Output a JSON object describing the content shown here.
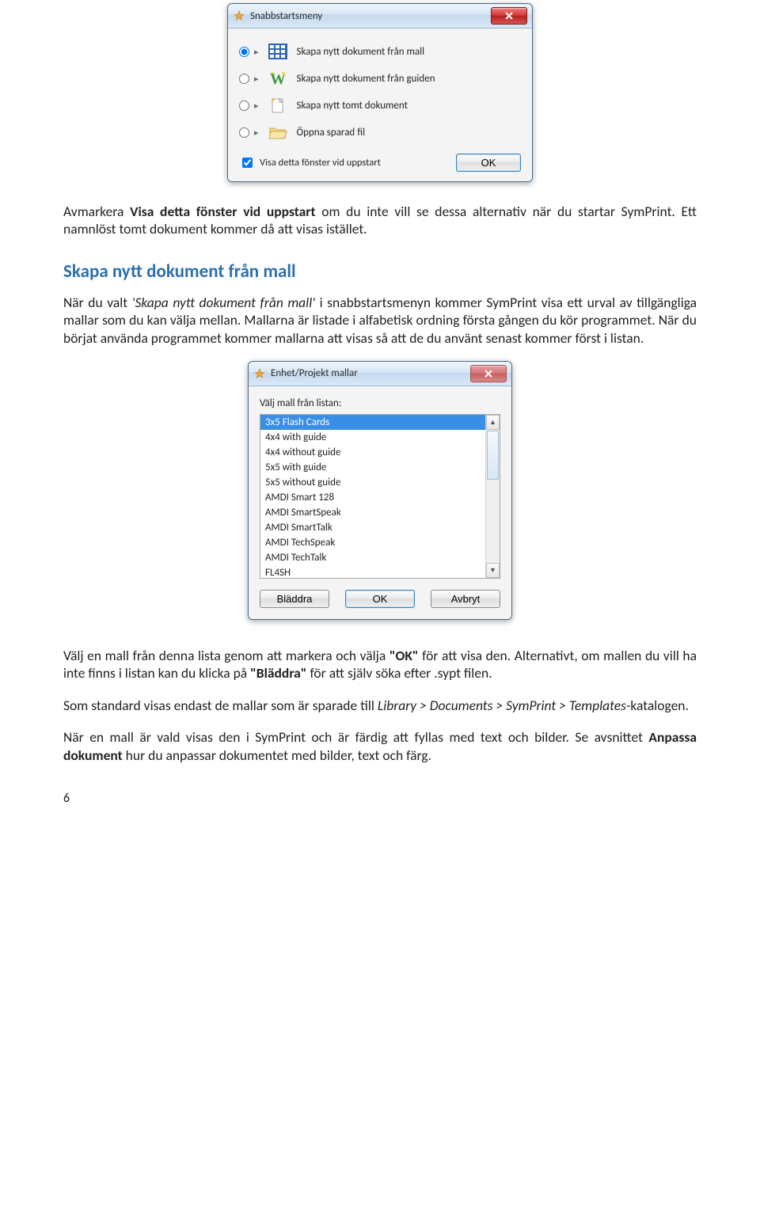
{
  "dialog1": {
    "title": "Snabbstartsmeny",
    "options": [
      {
        "label": "Skapa nytt dokument från mall",
        "icon": "grid-icon",
        "selected": true
      },
      {
        "label": "Skapa nytt dokument från guiden",
        "icon": "wizard-w-icon",
        "selected": false
      },
      {
        "label": "Skapa nytt tomt dokument",
        "icon": "new-doc-icon",
        "selected": false
      },
      {
        "label": "Öppna sparad fil",
        "icon": "folder-icon",
        "selected": false
      }
    ],
    "checkbox_label": "Visa detta fönster vid uppstart",
    "checkbox_checked": true,
    "ok_label": "OK"
  },
  "para1": {
    "pre": "Avmarkera ",
    "bold": "Visa detta fönster vid uppstart",
    "post": " om du inte vill se dessa alternativ när du startar SymPrint. Ett namnlöst tomt dokument kommer då att visas istället."
  },
  "section_heading": "Skapa nytt dokument från mall",
  "para2": {
    "pre": "När du valt ",
    "quoted": "'Skapa nytt dokument från mall'",
    "post": " i snabbstartsmenyn kommer SymPrint visa ett urval av tillgängliga mallar som du kan välja mellan. Mallarna är listade i alfabetisk ordning första gången du kör programmet. När du börjat använda programmet kommer mallarna att visas så att de du använt senast kommer först i listan."
  },
  "dialog2": {
    "title": "Enhet/Projekt mallar",
    "prompt": "Välj mall från listan:",
    "items": [
      "3x5 Flash Cards",
      "4x4 with guide",
      "4x4 without guide",
      "5x5 with guide",
      "5x5 without guide",
      "AMDI Smart 128",
      "AMDI SmartSpeak",
      "AMDI SmartTalk",
      "AMDI TechSpeak",
      "AMDI TechTalk",
      "FL4SH"
    ],
    "selected_index": 0,
    "browse_label": "Bläddra",
    "ok_label": "OK",
    "cancel_label": "Avbryt"
  },
  "para3": {
    "pre": "Välj en mall från denna lista genom att markera och välja ",
    "ok_bold": "\"OK\"",
    "mid": " för att visa den. Alternativt, om mallen du vill ha inte finns i listan kan du klicka på ",
    "browse_bold": "\"Bläddra\"",
    "post": " för att själv söka efter .sypt filen."
  },
  "para4": {
    "pre": "Som standard visas endast de mallar som är sparade till ",
    "path_italic": "Library > Documents > SymPrint > Templates",
    "post": "-katalogen."
  },
  "para5": {
    "pre": "När en mall är vald visas den i SymPrint och är färdig att fyllas med text och bilder. Se avsnittet ",
    "bold": "Anpassa dokument",
    "post": " hur du anpassar dokumentet med bilder, text och färg."
  },
  "page_number": "6"
}
